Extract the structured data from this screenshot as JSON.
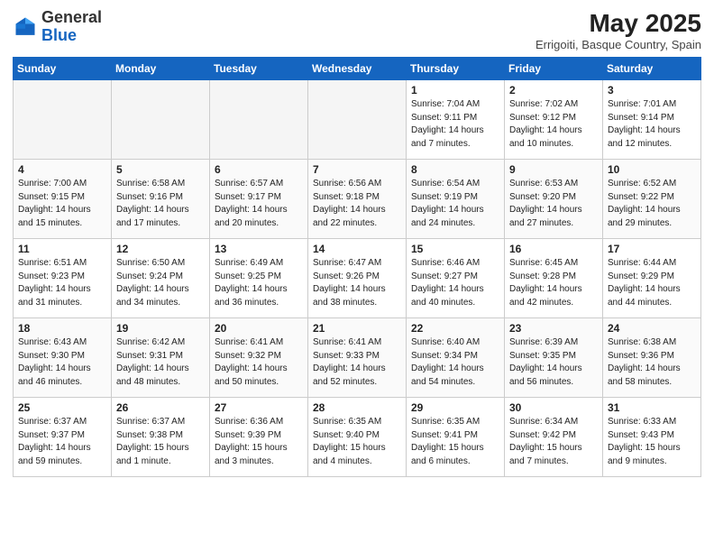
{
  "header": {
    "logo_general": "General",
    "logo_blue": "Blue",
    "month_title": "May 2025",
    "location": "Errigoiti, Basque Country, Spain"
  },
  "weekdays": [
    "Sunday",
    "Monday",
    "Tuesday",
    "Wednesday",
    "Thursday",
    "Friday",
    "Saturday"
  ],
  "weeks": [
    [
      {
        "day": "",
        "info": ""
      },
      {
        "day": "",
        "info": ""
      },
      {
        "day": "",
        "info": ""
      },
      {
        "day": "",
        "info": ""
      },
      {
        "day": "1",
        "info": "Sunrise: 7:04 AM\nSunset: 9:11 PM\nDaylight: 14 hours\nand 7 minutes."
      },
      {
        "day": "2",
        "info": "Sunrise: 7:02 AM\nSunset: 9:12 PM\nDaylight: 14 hours\nand 10 minutes."
      },
      {
        "day": "3",
        "info": "Sunrise: 7:01 AM\nSunset: 9:14 PM\nDaylight: 14 hours\nand 12 minutes."
      }
    ],
    [
      {
        "day": "4",
        "info": "Sunrise: 7:00 AM\nSunset: 9:15 PM\nDaylight: 14 hours\nand 15 minutes."
      },
      {
        "day": "5",
        "info": "Sunrise: 6:58 AM\nSunset: 9:16 PM\nDaylight: 14 hours\nand 17 minutes."
      },
      {
        "day": "6",
        "info": "Sunrise: 6:57 AM\nSunset: 9:17 PM\nDaylight: 14 hours\nand 20 minutes."
      },
      {
        "day": "7",
        "info": "Sunrise: 6:56 AM\nSunset: 9:18 PM\nDaylight: 14 hours\nand 22 minutes."
      },
      {
        "day": "8",
        "info": "Sunrise: 6:54 AM\nSunset: 9:19 PM\nDaylight: 14 hours\nand 24 minutes."
      },
      {
        "day": "9",
        "info": "Sunrise: 6:53 AM\nSunset: 9:20 PM\nDaylight: 14 hours\nand 27 minutes."
      },
      {
        "day": "10",
        "info": "Sunrise: 6:52 AM\nSunset: 9:22 PM\nDaylight: 14 hours\nand 29 minutes."
      }
    ],
    [
      {
        "day": "11",
        "info": "Sunrise: 6:51 AM\nSunset: 9:23 PM\nDaylight: 14 hours\nand 31 minutes."
      },
      {
        "day": "12",
        "info": "Sunrise: 6:50 AM\nSunset: 9:24 PM\nDaylight: 14 hours\nand 34 minutes."
      },
      {
        "day": "13",
        "info": "Sunrise: 6:49 AM\nSunset: 9:25 PM\nDaylight: 14 hours\nand 36 minutes."
      },
      {
        "day": "14",
        "info": "Sunrise: 6:47 AM\nSunset: 9:26 PM\nDaylight: 14 hours\nand 38 minutes."
      },
      {
        "day": "15",
        "info": "Sunrise: 6:46 AM\nSunset: 9:27 PM\nDaylight: 14 hours\nand 40 minutes."
      },
      {
        "day": "16",
        "info": "Sunrise: 6:45 AM\nSunset: 9:28 PM\nDaylight: 14 hours\nand 42 minutes."
      },
      {
        "day": "17",
        "info": "Sunrise: 6:44 AM\nSunset: 9:29 PM\nDaylight: 14 hours\nand 44 minutes."
      }
    ],
    [
      {
        "day": "18",
        "info": "Sunrise: 6:43 AM\nSunset: 9:30 PM\nDaylight: 14 hours\nand 46 minutes."
      },
      {
        "day": "19",
        "info": "Sunrise: 6:42 AM\nSunset: 9:31 PM\nDaylight: 14 hours\nand 48 minutes."
      },
      {
        "day": "20",
        "info": "Sunrise: 6:41 AM\nSunset: 9:32 PM\nDaylight: 14 hours\nand 50 minutes."
      },
      {
        "day": "21",
        "info": "Sunrise: 6:41 AM\nSunset: 9:33 PM\nDaylight: 14 hours\nand 52 minutes."
      },
      {
        "day": "22",
        "info": "Sunrise: 6:40 AM\nSunset: 9:34 PM\nDaylight: 14 hours\nand 54 minutes."
      },
      {
        "day": "23",
        "info": "Sunrise: 6:39 AM\nSunset: 9:35 PM\nDaylight: 14 hours\nand 56 minutes."
      },
      {
        "day": "24",
        "info": "Sunrise: 6:38 AM\nSunset: 9:36 PM\nDaylight: 14 hours\nand 58 minutes."
      }
    ],
    [
      {
        "day": "25",
        "info": "Sunrise: 6:37 AM\nSunset: 9:37 PM\nDaylight: 14 hours\nand 59 minutes."
      },
      {
        "day": "26",
        "info": "Sunrise: 6:37 AM\nSunset: 9:38 PM\nDaylight: 15 hours\nand 1 minute."
      },
      {
        "day": "27",
        "info": "Sunrise: 6:36 AM\nSunset: 9:39 PM\nDaylight: 15 hours\nand 3 minutes."
      },
      {
        "day": "28",
        "info": "Sunrise: 6:35 AM\nSunset: 9:40 PM\nDaylight: 15 hours\nand 4 minutes."
      },
      {
        "day": "29",
        "info": "Sunrise: 6:35 AM\nSunset: 9:41 PM\nDaylight: 15 hours\nand 6 minutes."
      },
      {
        "day": "30",
        "info": "Sunrise: 6:34 AM\nSunset: 9:42 PM\nDaylight: 15 hours\nand 7 minutes."
      },
      {
        "day": "31",
        "info": "Sunrise: 6:33 AM\nSunset: 9:43 PM\nDaylight: 15 hours\nand 9 minutes."
      }
    ]
  ]
}
